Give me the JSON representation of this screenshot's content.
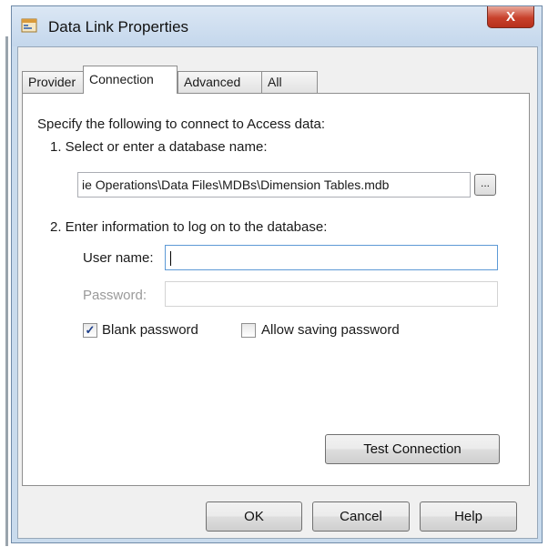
{
  "window": {
    "title": "Data Link Properties",
    "close_label": "X"
  },
  "tabs": [
    {
      "label": "Provider"
    },
    {
      "label": "Connection"
    },
    {
      "label": "Advanced"
    },
    {
      "label": "All"
    }
  ],
  "active_tab": "Connection",
  "connection": {
    "intro": "Specify the following to connect to Access data:",
    "step1_label": "1. Select or enter a database name:",
    "database_value": "ie Operations\\Data Files\\MDBs\\Dimension Tables.mdb",
    "browse_label": "...",
    "step2_label": "2. Enter information to log on to the database:",
    "username_label": "User name:",
    "username_value": "",
    "password_label": "Password:",
    "password_value": "",
    "blank_password_label": "Blank password",
    "blank_password_checked": true,
    "allow_saving_label": "Allow saving password",
    "allow_saving_checked": false,
    "test_connection_label": "Test Connection"
  },
  "footer": {
    "ok_label": "OK",
    "cancel_label": "Cancel",
    "help_label": "Help"
  }
}
